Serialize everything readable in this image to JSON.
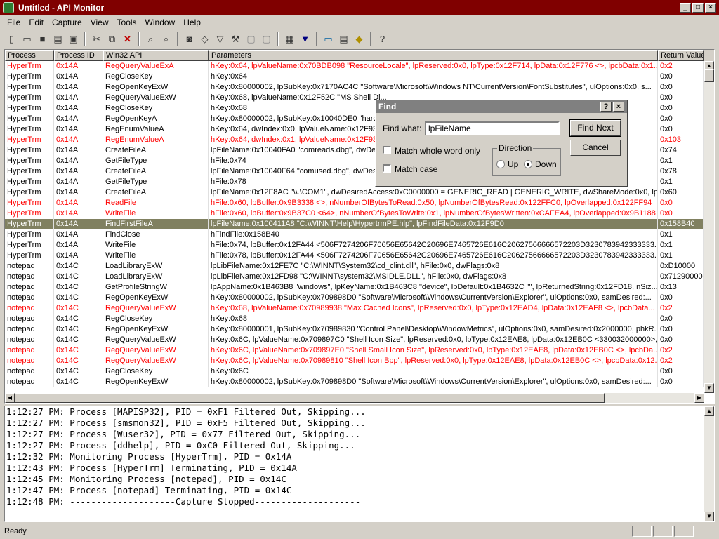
{
  "window": {
    "title": "Untitled - API Monitor",
    "caption_buttons": [
      "_",
      "□",
      "×"
    ]
  },
  "menu": [
    "File",
    "Edit",
    "Capture",
    "View",
    "Tools",
    "Window",
    "Help"
  ],
  "toolbar": [
    "new-icon",
    "open-icon",
    "save-icon",
    "print-icon",
    "print-preview-icon",
    "|",
    "cut-icon",
    "copy-icon",
    "delete-icon",
    "|",
    "find-icon",
    "find-next-icon",
    "|",
    "capture-icon",
    "eraser-icon",
    "filter-icon",
    "tools-icon",
    "window-icon",
    "window2-icon",
    "|",
    "grid-icon",
    "download-icon",
    "|",
    "monitor-icon",
    "properties-icon",
    "warning-icon",
    "|",
    "help-icon"
  ],
  "grid": {
    "columns": [
      "Process",
      "Process ID",
      "Win32 API",
      "Parameters",
      "Return Value"
    ],
    "rows": [
      {
        "p": "HyperTrm",
        "id": "0x14A",
        "api": "RegQueryValueExA",
        "params": "hKey:0x64, lpValueName:0x70BDB098 \"ResourceLocale\", lpReserved:0x0, lpType:0x12F714, lpData:0x12F776 <>, lpcbData:0x1...",
        "ret": "0x2",
        "style": "red"
      },
      {
        "p": "HyperTrm",
        "id": "0x14A",
        "api": "RegCloseKey",
        "params": "hKey:0x64",
        "ret": "0x0",
        "style": ""
      },
      {
        "p": "HyperTrm",
        "id": "0x14A",
        "api": "RegOpenKeyExW",
        "params": "hKey:0x80000002, lpSubKey:0x7170AC4C \"Software\\Microsoft\\Windows NT\\CurrentVersion\\FontSubstitutes\", ulOptions:0x0, s...",
        "ret": "0x0",
        "style": ""
      },
      {
        "p": "HyperTrm",
        "id": "0x14A",
        "api": "RegQueryValueExW",
        "params": "hKey:0x68, lpValueName:0x12F52C \"MS Shell Dl...",
        "ret": "0x0",
        "style": ""
      },
      {
        "p": "HyperTrm",
        "id": "0x14A",
        "api": "RegCloseKey",
        "params": "hKey:0x68",
        "ret": "0x0",
        "style": ""
      },
      {
        "p": "HyperTrm",
        "id": "0x14A",
        "api": "RegOpenKeyA",
        "params": "hKey:0x80000002, lpSubKey:0x10040DE0 \"harc...",
        "ret": "0x0",
        "style": ""
      },
      {
        "p": "HyperTrm",
        "id": "0x14A",
        "api": "RegEnumValueA",
        "params": "hKey:0x64, dwIndex:0x0, lpValueName:0x12F93...",
        "ret": "0x0",
        "style": ""
      },
      {
        "p": "HyperTrm",
        "id": "0x14A",
        "api": "RegEnumValueA",
        "params": "hKey:0x64, dwIndex:0x1, lpValueName:0x12F93...",
        "ret": "0x103",
        "style": "red"
      },
      {
        "p": "HyperTrm",
        "id": "0x14A",
        "api": "CreateFileA",
        "params": "lpFileName:0x10040FA0 \"comreads.dbg\", dwDes...",
        "ret": "0x74",
        "style": ""
      },
      {
        "p": "HyperTrm",
        "id": "0x14A",
        "api": "GetFileType",
        "params": "hFile:0x74",
        "ret": "0x1",
        "style": ""
      },
      {
        "p": "HyperTrm",
        "id": "0x14A",
        "api": "CreateFileA",
        "params": "lpFileName:0x10040F64 \"comused.dbg\", dwDes...",
        "ret": "0x78",
        "style": ""
      },
      {
        "p": "HyperTrm",
        "id": "0x14A",
        "api": "GetFileType",
        "params": "hFile:0x78",
        "ret": "0x1",
        "style": ""
      },
      {
        "p": "HyperTrm",
        "id": "0x14A",
        "api": "CreateFileA",
        "params": "lpFileName:0x12F8AC \"\\\\.\\COM1\", dwDesiredAccess:0xC0000000 = GENERIC_READ | GENERIC_WRITE, dwShareMode:0x0, lpSe...",
        "ret": "0x60",
        "style": ""
      },
      {
        "p": "HyperTrm",
        "id": "0x14A",
        "api": "ReadFile",
        "params": "hFile:0x60, lpBuffer:0x9B3338 <>, nNumberOfBytesToRead:0x50, lpNumberOfBytesRead:0x122FFC0, lpOverlapped:0x122FF94",
        "ret": "0x0",
        "style": "red"
      },
      {
        "p": "HyperTrm",
        "id": "0x14A",
        "api": "WriteFile",
        "params": "hFile:0x60, lpBuffer:0x9B37C0 <64>, nNumberOfBytesToWrite:0x1, lpNumberOfBytesWritten:0xCAFEA4, lpOverlapped:0x9B1188",
        "ret": "0x0",
        "style": "red"
      },
      {
        "p": "HyperTrm",
        "id": "0x14A",
        "api": "FindFirstFileA",
        "params": "lpFileName:0x100411A8 \"C:\\WINNT\\Help\\HypertrmPE.hlp\", lpFindFileData:0x12F9D0",
        "ret": "0x158B40",
        "style": "sel"
      },
      {
        "p": "HyperTrm",
        "id": "0x14A",
        "api": "FindClose",
        "params": "hFindFile:0x158B40",
        "ret": "0x1",
        "style": ""
      },
      {
        "p": "HyperTrm",
        "id": "0x14A",
        "api": "WriteFile",
        "params": "hFile:0x74, lpBuffer:0x12FA44 <506F7274206F70656E65642C20696E7465726E616C20627566666572203D3230783942333333...",
        "ret": "0x1",
        "style": ""
      },
      {
        "p": "HyperTrm",
        "id": "0x14A",
        "api": "WriteFile",
        "params": "hFile:0x78, lpBuffer:0x12FA44 <506F7274206F70656E65642C20696E7465726E616C20627566666572203D3230783942333333...",
        "ret": "0x1",
        "style": ""
      },
      {
        "p": "notepad",
        "id": "0x14C",
        "api": "LoadLibraryExW",
        "params": "lpLibFileName:0x12FE7C \"C:\\WINNT\\System32\\cd_clint.dll\", hFile:0x0, dwFlags:0x8",
        "ret": "0xD10000",
        "style": ""
      },
      {
        "p": "notepad",
        "id": "0x14C",
        "api": "LoadLibraryExW",
        "params": "lpLibFileName:0x12FD98 \"C:\\WINNT\\system32\\MSIDLE.DLL\", hFile:0x0, dwFlags:0x8",
        "ret": "0x71290000",
        "style": ""
      },
      {
        "p": "notepad",
        "id": "0x14C",
        "api": "GetProfileStringW",
        "params": "lpAppName:0x1B463B8 \"windows\", lpKeyName:0x1B463C8 \"device\", lpDefault:0x1B4632C \"\", lpReturnedString:0x12FD18, nSiz...",
        "ret": "0x13",
        "style": ""
      },
      {
        "p": "notepad",
        "id": "0x14C",
        "api": "RegOpenKeyExW",
        "params": "hKey:0x80000002, lpSubKey:0x709898D0 \"Software\\Microsoft\\Windows\\CurrentVersion\\Explorer\", ulOptions:0x0, samDesired:...",
        "ret": "0x0",
        "style": ""
      },
      {
        "p": "notepad",
        "id": "0x14C",
        "api": "RegQueryValueExW",
        "params": "hKey:0x68, lpValueName:0x70989938 \"Max Cached Icons\", lpReserved:0x0, lpType:0x12EAD4, lpData:0x12EAF8 <>, lpcbData...",
        "ret": "0x2",
        "style": "red"
      },
      {
        "p": "notepad",
        "id": "0x14C",
        "api": "RegCloseKey",
        "params": "hKey:0x68",
        "ret": "0x0",
        "style": ""
      },
      {
        "p": "notepad",
        "id": "0x14C",
        "api": "RegOpenKeyExW",
        "params": "hKey:0x80000001, lpSubKey:0x70989830 \"Control Panel\\Desktop\\WindowMetrics\", ulOptions:0x0, samDesired:0x2000000, phkR...",
        "ret": "0x0",
        "style": ""
      },
      {
        "p": "notepad",
        "id": "0x14C",
        "api": "RegQueryValueExW",
        "params": "hKey:0x6C, lpValueName:0x709897C0 \"Shell Icon Size\", lpReserved:0x0, lpType:0x12EAE8, lpData:0x12EB0C <330032000000>,...",
        "ret": "0x0",
        "style": ""
      },
      {
        "p": "notepad",
        "id": "0x14C",
        "api": "RegQueryValueExW",
        "params": "hKey:0x6C, lpValueName:0x709897E0 \"Shell Small Icon Size\", lpReserved:0x0, lpType:0x12EAE8, lpData:0x12EB0C <>, lpcbDa...",
        "ret": "0x2",
        "style": "red"
      },
      {
        "p": "notepad",
        "id": "0x14C",
        "api": "RegQueryValueExW",
        "params": "hKey:0x6C, lpValueName:0x70989810 \"Shell Icon Bpp\", lpReserved:0x0, lpType:0x12EAE8, lpData:0x12EB0C <>, lpcbData:0x12...",
        "ret": "0x2",
        "style": "red"
      },
      {
        "p": "notepad",
        "id": "0x14C",
        "api": "RegCloseKey",
        "params": "hKey:0x6C",
        "ret": "0x0",
        "style": ""
      },
      {
        "p": "notepad",
        "id": "0x14C",
        "api": "RegOpenKeyExW",
        "params": "hKey:0x80000002, lpSubKey:0x709898D0 \"Software\\Microsoft\\Windows\\CurrentVersion\\Explorer\", ulOptions:0x0, samDesired:...",
        "ret": "0x0",
        "style": ""
      }
    ]
  },
  "log": [
    "1:12:27 PM: Process [MAPISP32], PID = 0xF1 Filtered Out, Skipping...",
    "1:12:27 PM: Process [smsmon32], PID = 0xF5 Filtered Out, Skipping...",
    "1:12:27 PM: Process [Wuser32], PID = 0x77 Filtered Out, Skipping...",
    "1:12:27 PM: Process [ddhelp], PID = 0xC0 Filtered Out, Skipping...",
    "1:12:32 PM: Monitoring Process [HyperTrm], PID = 0x14A",
    "1:12:43 PM: Process [HyperTrm] Terminating, PID = 0x14A",
    "1:12:45 PM: Monitoring Process [notepad], PID = 0x14C",
    "1:12:47 PM: Process [notepad] Terminating, PID = 0x14C",
    "1:12:48 PM: --------------------Capture Stopped--------------------"
  ],
  "status": {
    "text": "Ready"
  },
  "find_dialog": {
    "title": "Find",
    "help_btn": "?",
    "close_btn": "×",
    "find_what_label": "Find what:",
    "find_what_value": "lpFileName",
    "match_whole_word": "Match whole word only",
    "match_case": "Match case",
    "direction_label": "Direction",
    "up_label": "Up",
    "down_label": "Down",
    "find_next": "Find Next",
    "cancel": "Cancel"
  }
}
